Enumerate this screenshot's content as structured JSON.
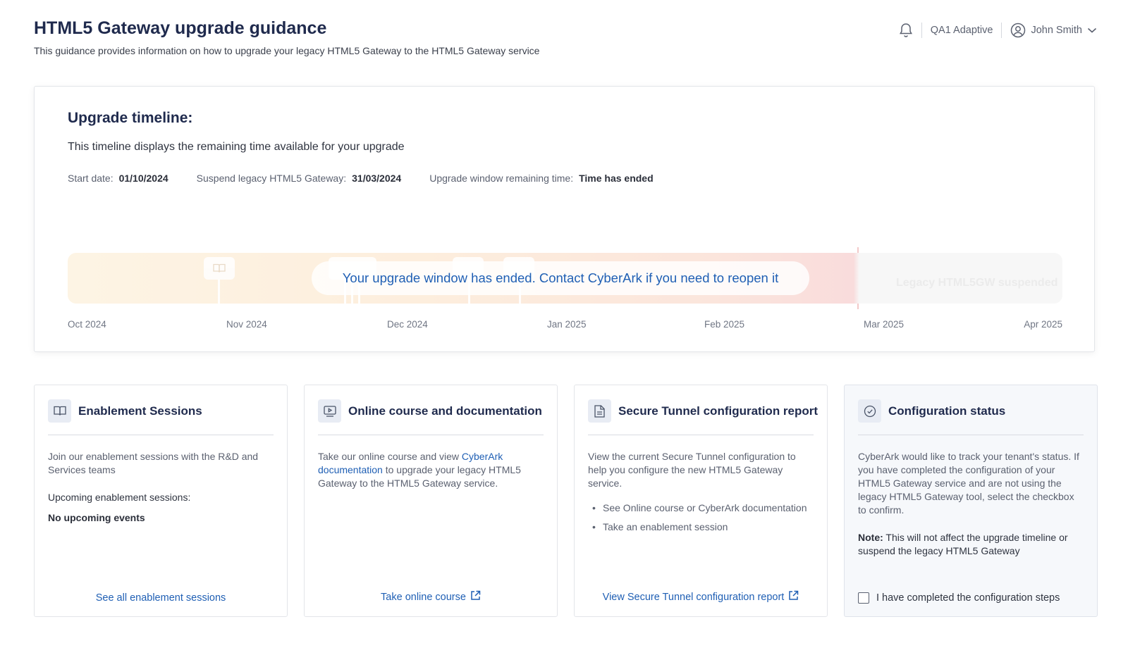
{
  "header": {
    "title": "HTML5 Gateway upgrade guidance",
    "subtitle": "This guidance provides information on how to upgrade your legacy HTML5 Gateway to the HTML5 Gateway service",
    "tenant": "QA1 Adaptive",
    "user": "John Smith",
    "icons": [
      "bell-icon",
      "user-circle-icon",
      "chevron-down-icon"
    ]
  },
  "timeline": {
    "heading": "Upgrade timeline:",
    "description": "This timeline displays the remaining time available for your upgrade",
    "start_label": "Start date:",
    "start_value": "01/10/2024",
    "suspend_label": "Suspend legacy HTML5 Gateway:",
    "suspend_value": "31/03/2024",
    "remaining_label": "Upgrade window remaining time:",
    "remaining_value": "Time has ended",
    "overlay_message": "Your upgrade window has ended. Contact CyberArk if you need to reopen it",
    "suspended_label": "Legacy HTML5GW suspended",
    "axis_labels": [
      "Oct 2024",
      "Nov 2024",
      "Dec 2024",
      "Jan 2025",
      "Feb 2025",
      "Mar 2025",
      "Apr 2025"
    ],
    "colors": {
      "start": "#fdf4e4",
      "end": "#f9dcdc",
      "message": "#1f5fb4"
    }
  },
  "cards": {
    "enablement": {
      "title": "Enablement Sessions",
      "icon": "book-icon",
      "body": "Join our enablement sessions with the R&D and Services teams",
      "upcoming_label": "Upcoming enablement sessions:",
      "upcoming_value": "No upcoming events",
      "link": "See all enablement sessions"
    },
    "course": {
      "title": "Online course and documentation",
      "icon": "video-icon",
      "body_before": "Take our online course and view ",
      "body_link": "CyberArk documentation",
      "body_after": " to upgrade your legacy HTML5 Gateway to the HTML5 Gateway service.",
      "link": "Take online course"
    },
    "tunnel": {
      "title": "Secure Tunnel configuration report",
      "icon": "document-icon",
      "body": "View the current Secure Tunnel configuration to help you configure the new HTML5 Gateway service.",
      "bullets": [
        "See Online course or CyberArk documentation",
        "Take an enablement session"
      ],
      "link": "View Secure Tunnel configuration report"
    },
    "status": {
      "title": "Configuration status",
      "icon": "check-circle-icon",
      "body": "CyberArk would like to track your tenant's status. If you have completed the configuration of your HTML5 Gateway service and are not using the legacy HTML5 Gateway tool, select the checkbox to confirm.",
      "note_label": "Note:",
      "note_text": " This will not affect the upgrade timeline or suspend the legacy HTML5 Gateway",
      "checkbox_label": "I have completed the configuration steps",
      "checked": false
    }
  }
}
